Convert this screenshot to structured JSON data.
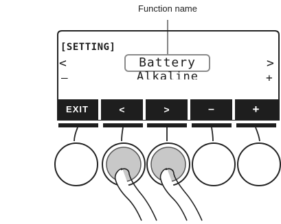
{
  "callout": {
    "label": "Function name"
  },
  "lcd": {
    "mode": "[SETTING]",
    "nav_left": "<",
    "nav_right": ">",
    "value_left": "–",
    "value_right": "+",
    "function_name": "Battery",
    "function_value": "Alkaline"
  },
  "softkeys": [
    "EXIT",
    "<",
    ">",
    "–",
    "+"
  ],
  "colors": {
    "lcd_bar": "#1e1e1e",
    "highlight_button": "#c8c8c8",
    "outline": "#222222"
  }
}
